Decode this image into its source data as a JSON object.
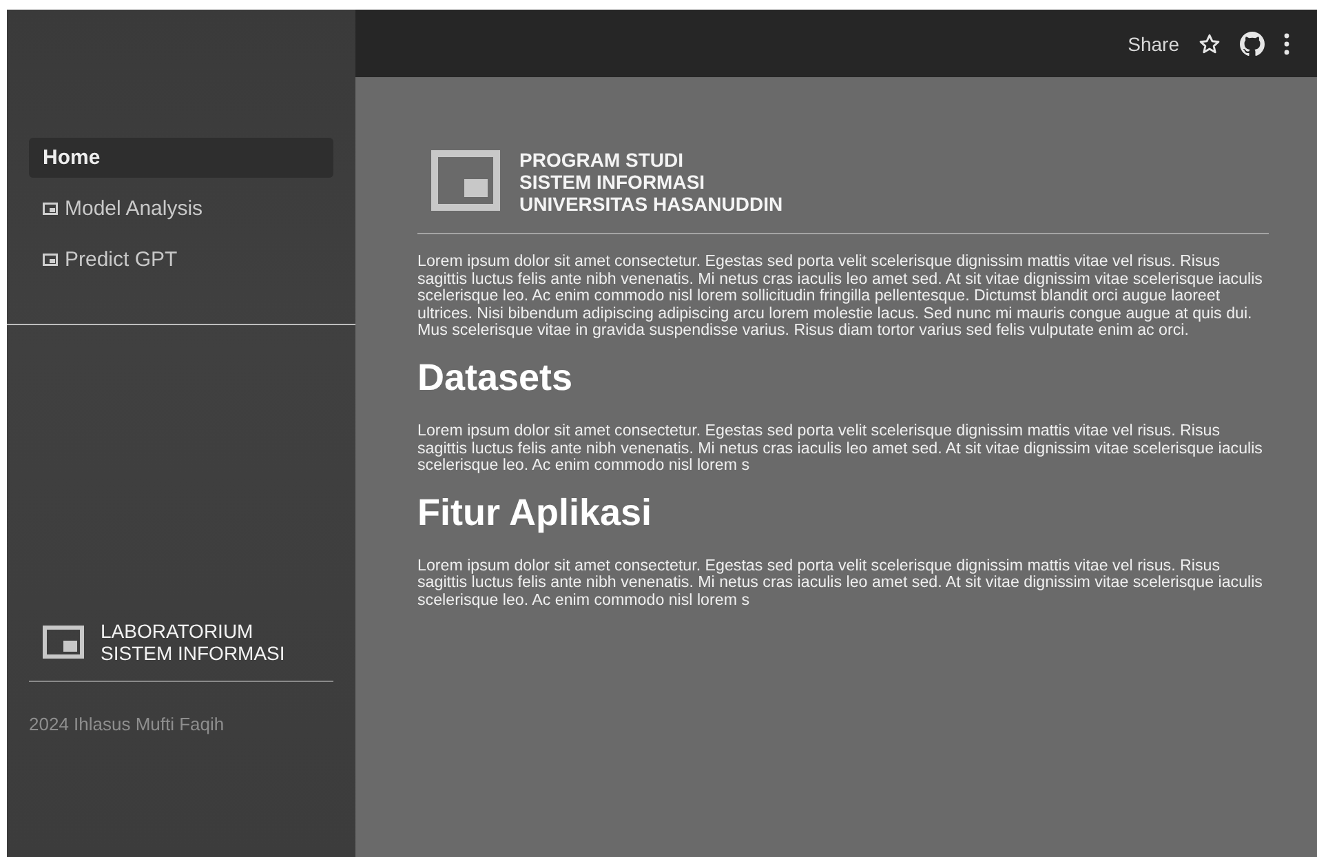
{
  "sidebar": {
    "items": [
      {
        "label": "Home",
        "selected": true,
        "icon": false
      },
      {
        "label": "Model Analysis",
        "selected": false,
        "icon": true
      },
      {
        "label": "Predict GPT",
        "selected": false,
        "icon": true
      }
    ],
    "brand": {
      "lines": [
        "LABORATORIUM",
        "SISTEM INFORMASI"
      ]
    },
    "footer": "2024 Ihlasus Mufti Faqih"
  },
  "toolbar": {
    "share": "Share"
  },
  "header": {
    "lines": [
      "PROGRAM STUDI",
      "SISTEM INFORMASI",
      "UNIVERSITAS HASANUDDIN"
    ]
  },
  "content": [
    {
      "kind": "paragraph",
      "text": "Lorem ipsum dolor sit amet consectetur. Egestas sed porta velit scelerisque dignissim mattis vitae vel risus. Risus sagittis luctus felis ante nibh venenatis. Mi netus cras iaculis leo amet sed. At sit vitae dignissim vitae scelerisque iaculis scelerisque leo. Ac enim commodo nisl lorem sollicitudin fringilla pellentesque. Dictumst blandit orci augue laoreet ultrices. Nisi bibendum adipiscing adipiscing arcu lorem molestie lacus. Sed nunc mi mauris congue augue at quis dui. Mus scelerisque vitae in gravida suspendisse varius. Risus diam tortor varius sed felis vulputate enim ac orci."
    },
    {
      "kind": "heading",
      "text": "Datasets"
    },
    {
      "kind": "paragraph",
      "text": "Lorem ipsum dolor sit amet consectetur. Egestas sed porta velit scelerisque dignissim mattis vitae vel risus. Risus sagittis luctus felis ante nibh venenatis. Mi netus cras iaculis leo amet sed. At sit vitae dignissim vitae scelerisque iaculis scelerisque leo. Ac enim commodo nisl lorem s"
    },
    {
      "kind": "heading",
      "text": "Fitur Aplikasi"
    },
    {
      "kind": "paragraph",
      "text": "Lorem ipsum dolor sit amet consectetur. Egestas sed porta velit scelerisque dignissim mattis vitae vel risus. Risus sagittis luctus felis ante nibh venenatis. Mi netus cras iaculis leo amet sed. At sit vitae dignissim vitae scelerisque iaculis scelerisque leo. Ac enim commodo nisl lorem s"
    }
  ]
}
